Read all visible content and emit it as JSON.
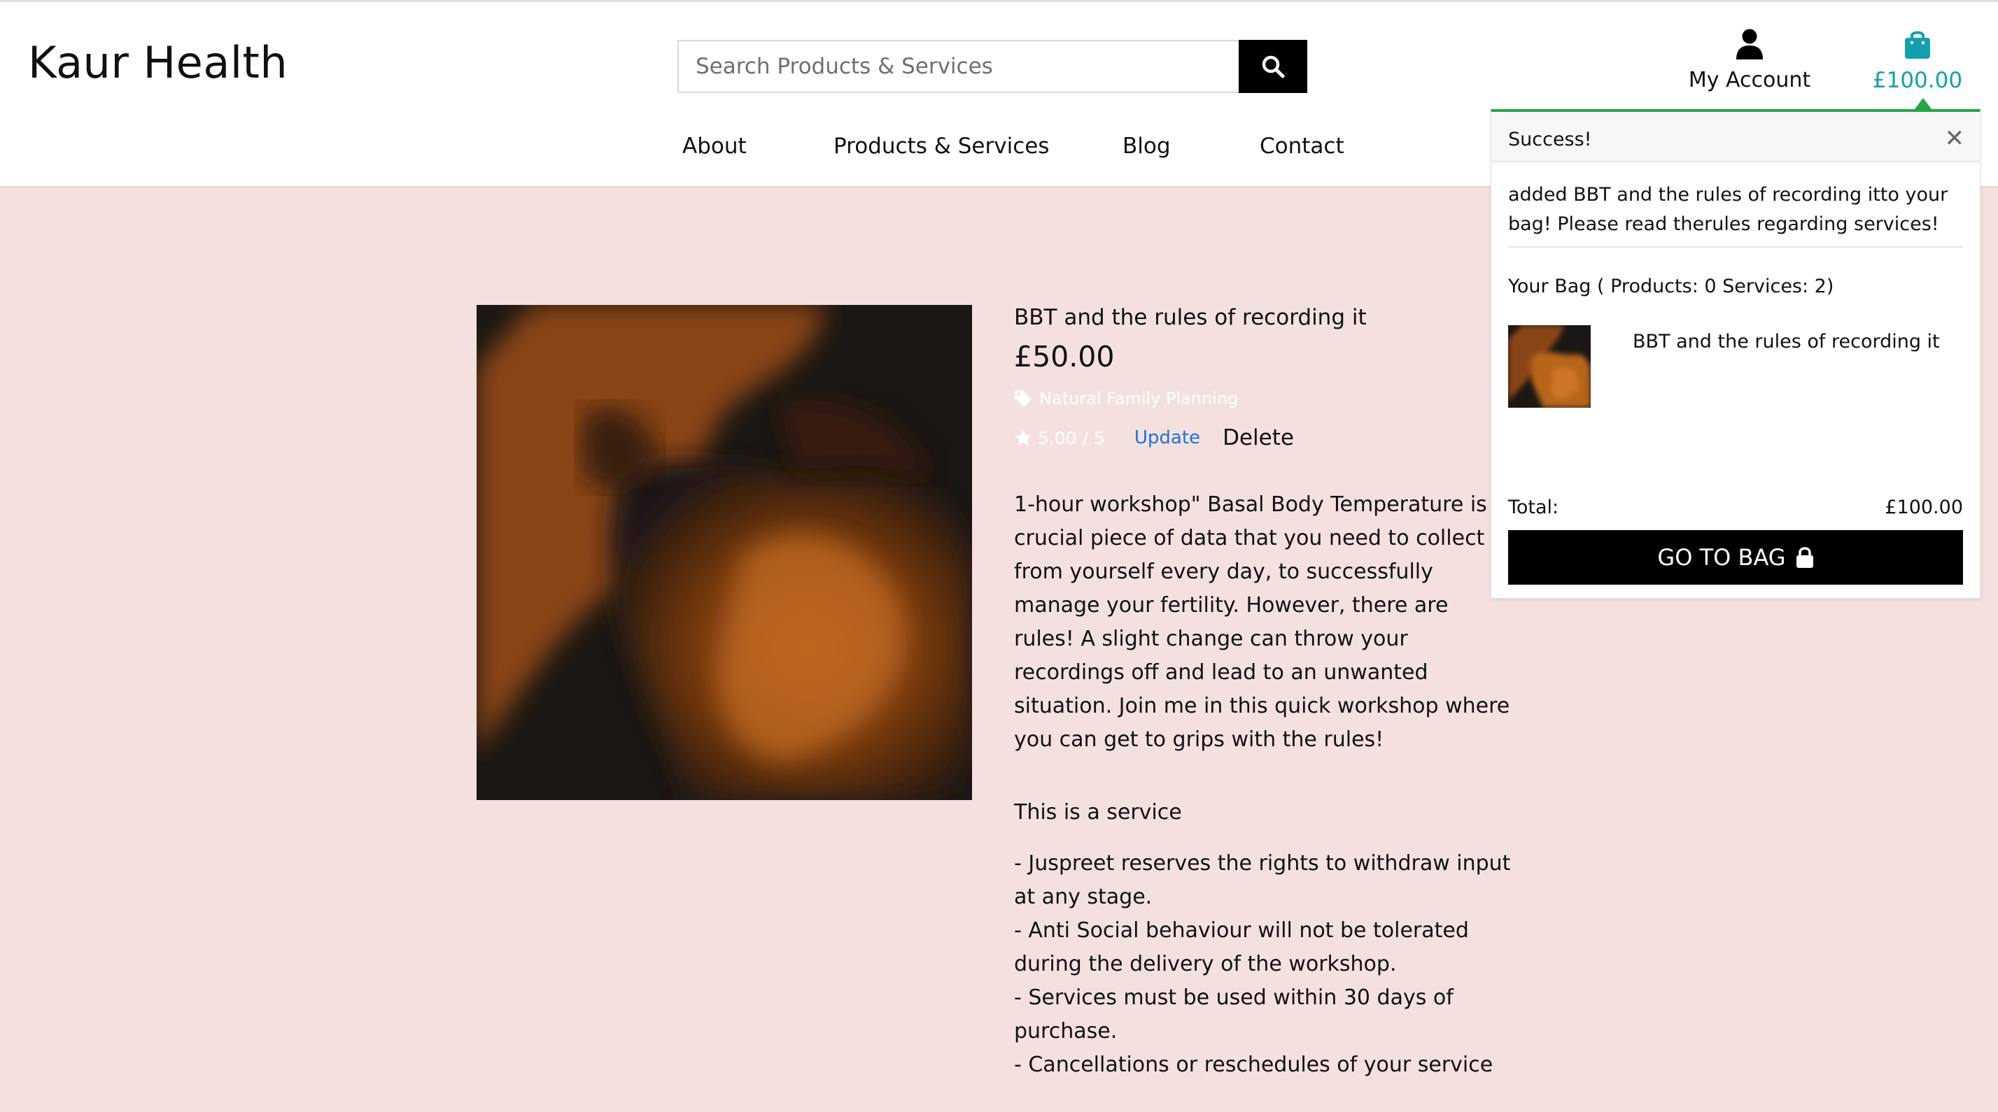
{
  "site": {
    "logo": "Kaur Health"
  },
  "search": {
    "placeholder": "Search Products & Services"
  },
  "account": {
    "label": "My Account",
    "icon": "user-icon"
  },
  "bag": {
    "total": "£100.00",
    "icon": "shopping-bag-icon",
    "color": "#149fb0"
  },
  "nav": {
    "items": [
      "About",
      "Products & Services",
      "Blog",
      "Contact"
    ]
  },
  "product": {
    "name": "BBT and the rules of recording it",
    "price": "£50.00",
    "category": "Natural Family Planning",
    "rating": "5.00 / 5",
    "update_label": "Update",
    "delete_label": "Delete",
    "description": "1-hour workshop\" Basal Body Temperature is a crucial piece of data that you need to collect from yourself every day, to successfully manage your fertility. However, there are rules! A slight change can throw your recordings off and lead to an unwanted situation. Join me in this quick workshop where you can get to grips with the rules!",
    "service_heading": "This is a service",
    "rules": [
      "- Juspreet reserves the rights to withdraw input at any stage.",
      "- Anti Social behaviour will not be tolerated during the delivery of the workshop.",
      "- Services must be used within 30 days of purchase.",
      "- Cancellations or reschedules of your service"
    ]
  },
  "toast": {
    "title": "Success!",
    "message": "added BBT and the rules of recording itto your bag! Please read therules regarding services!",
    "bag_summary": "Your Bag ( Products: 0 Services: 2)",
    "item_name": "BBT and the rules of recording it",
    "total_label": "Total:",
    "total_value": "£100.00",
    "go_to_bag": "GO TO BAG",
    "accent": "#28a745"
  }
}
